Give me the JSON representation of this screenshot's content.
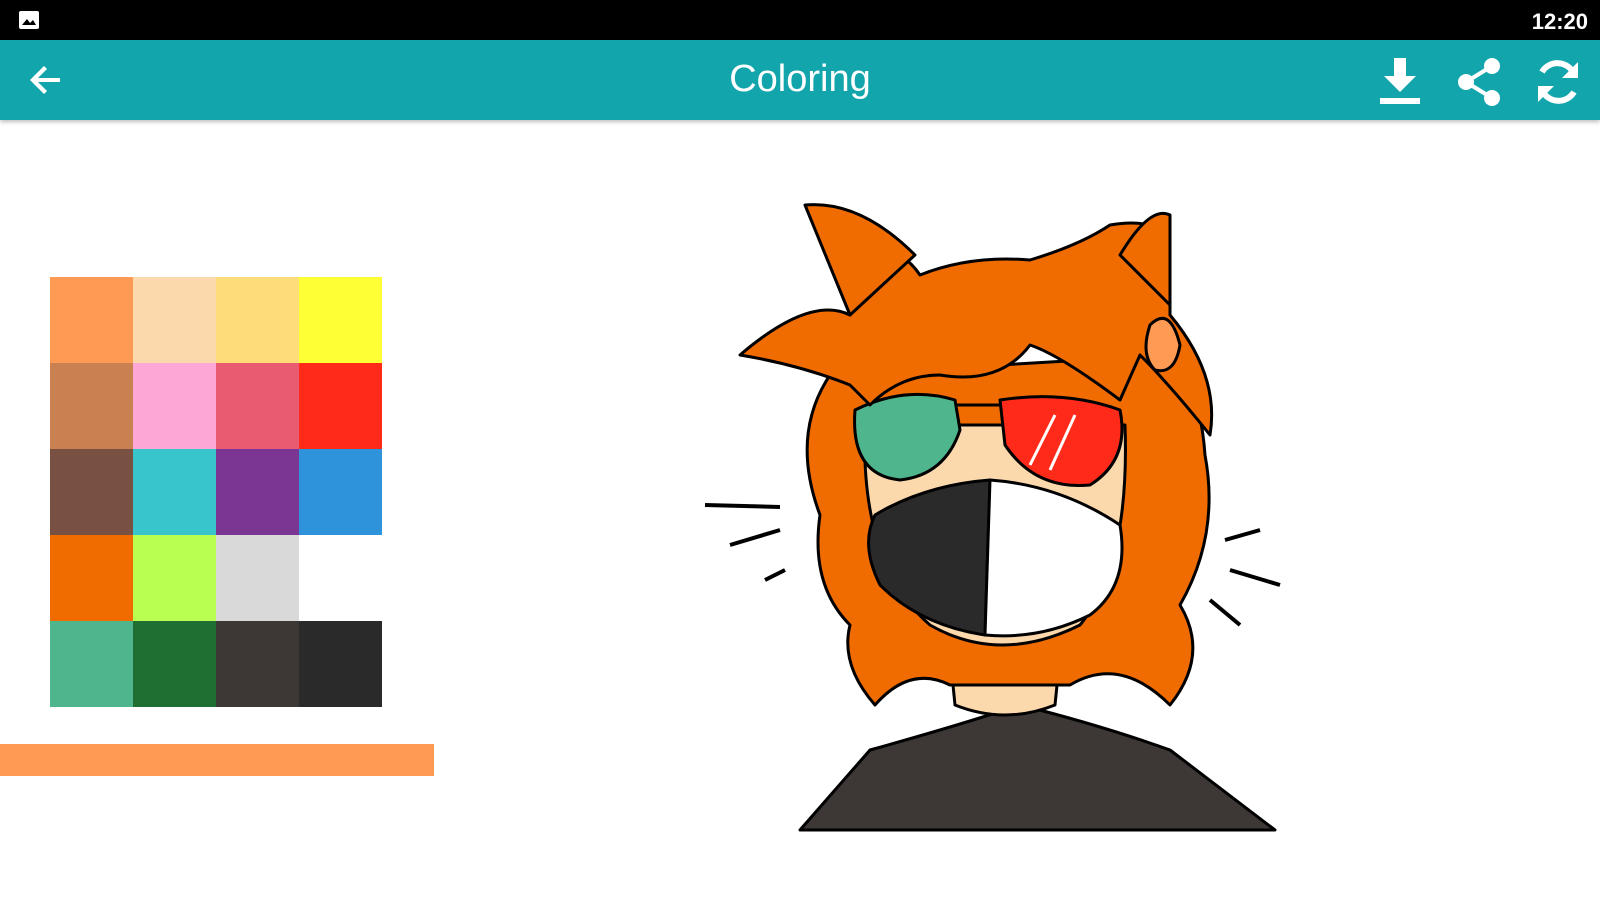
{
  "status_bar": {
    "time": "12:20",
    "left_icon": "gallery-icon"
  },
  "app_bar": {
    "title": "Coloring",
    "back_icon": "back-arrow-icon",
    "actions": [
      {
        "name": "download",
        "icon": "download-icon"
      },
      {
        "name": "share",
        "icon": "share-icon"
      },
      {
        "name": "reset",
        "icon": "refresh-icon"
      }
    ],
    "color": "#13a5ac"
  },
  "palette": {
    "colors": [
      "#ff9a55",
      "#fcd9ad",
      "#fedc79",
      "#feff35",
      "#c98152",
      "#fda7d6",
      "#e85b71",
      "#ff2a19",
      "#785142",
      "#38c6cc",
      "#7b3593",
      "#2f93db",
      "#f06c00",
      "#b9ff51",
      "#d9d9d9",
      "#ffffff",
      "#4eb58d",
      "#1f6e32",
      "#3d3736",
      "#2b2a2b"
    ],
    "selected_color": "#ff9a55"
  }
}
